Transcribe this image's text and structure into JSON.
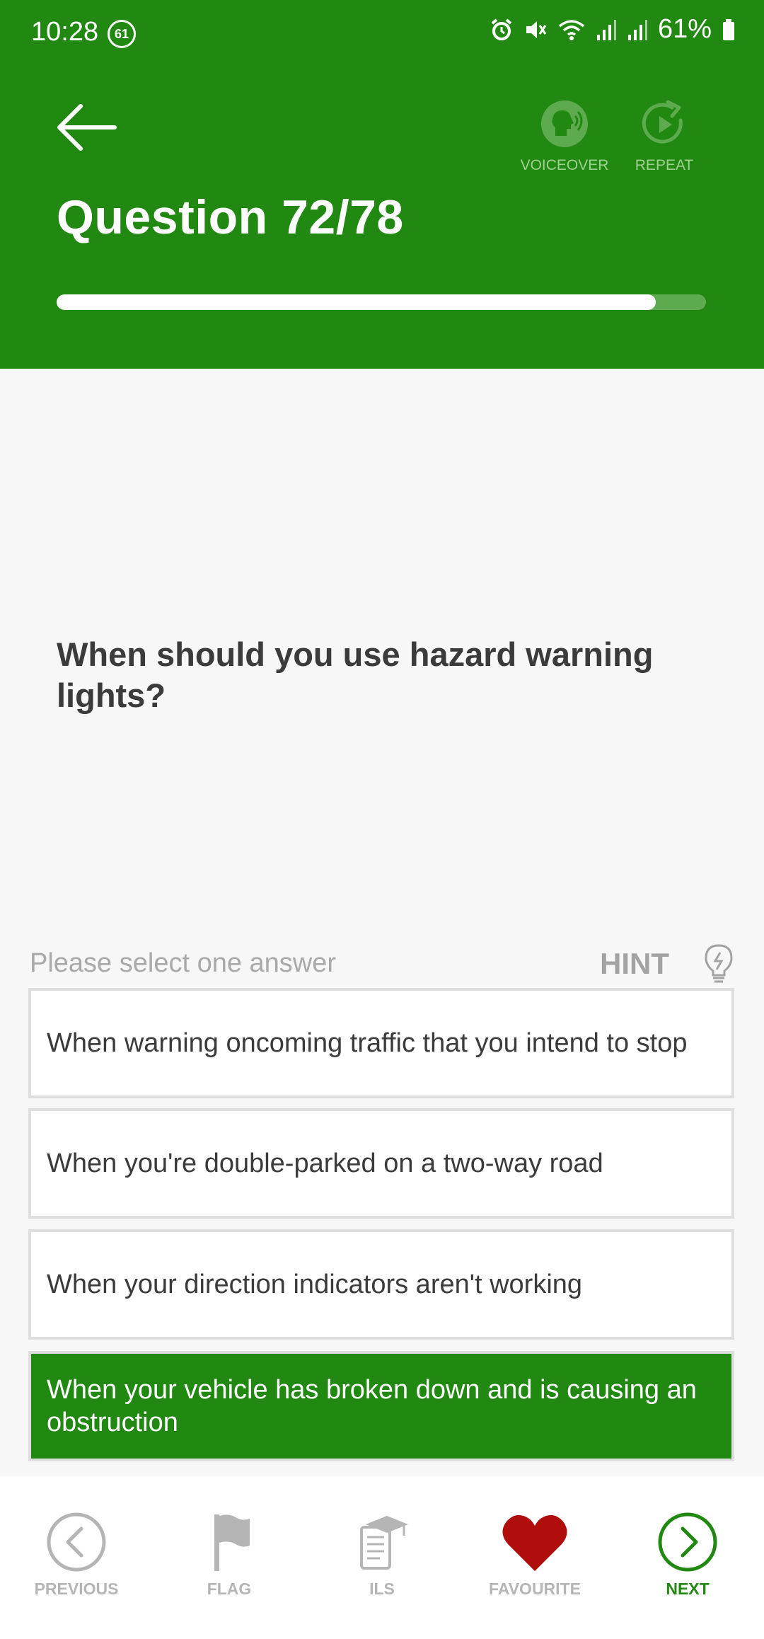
{
  "status_bar": {
    "time": "10:28",
    "notification_badge": "61",
    "battery_percent": "61%"
  },
  "header": {
    "title": "Question 72/78",
    "voiceover_label": "VOICEOVER",
    "repeat_label": "REPEAT",
    "progress_fraction": 0.923
  },
  "question": {
    "text": "When should you use hazard warning lights?"
  },
  "answers_section": {
    "prompt": "Please select one answer",
    "hint_label": "HINT"
  },
  "answers": [
    {
      "text": "When warning oncoming traffic that you intend to stop",
      "selected": false
    },
    {
      "text": "When you're double-parked on a two-way road",
      "selected": false
    },
    {
      "text": "When your direction indicators aren't working",
      "selected": false
    },
    {
      "text": "When your vehicle has broken down and is causing an obstruction",
      "selected": true
    }
  ],
  "bottom_nav": {
    "previous": "PREVIOUS",
    "flag": "FLAG",
    "ils": "ILS",
    "favourite": "FAVOURITE",
    "next": "NEXT"
  },
  "colors": {
    "brand_green": "#218812",
    "favourite_red": "#b00d0d",
    "muted_gray": "#b5b5b5"
  }
}
